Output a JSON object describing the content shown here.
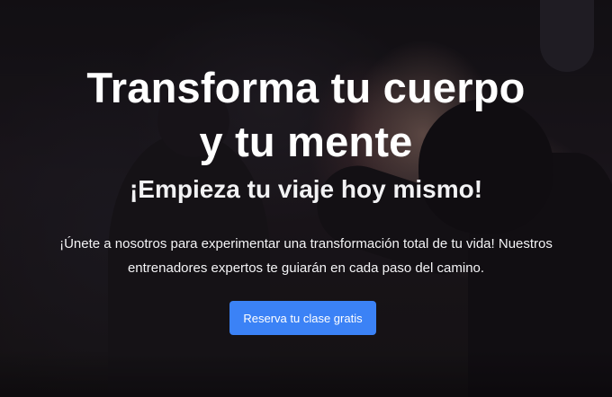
{
  "hero": {
    "title_line1": "Transforma tu cuerpo",
    "title_line2": "y tu mente",
    "subtitle": "¡Empieza tu viaje hoy mismo!",
    "description": "¡Únete a nosotros para experimentar una transformación total de tu vida! Nuestros entrenadores expertos te guiarán en cada paso del camino.",
    "cta_label": "Reserva tu clase gratis"
  },
  "colors": {
    "cta_background": "#3b82f6",
    "text": "#ffffff"
  }
}
